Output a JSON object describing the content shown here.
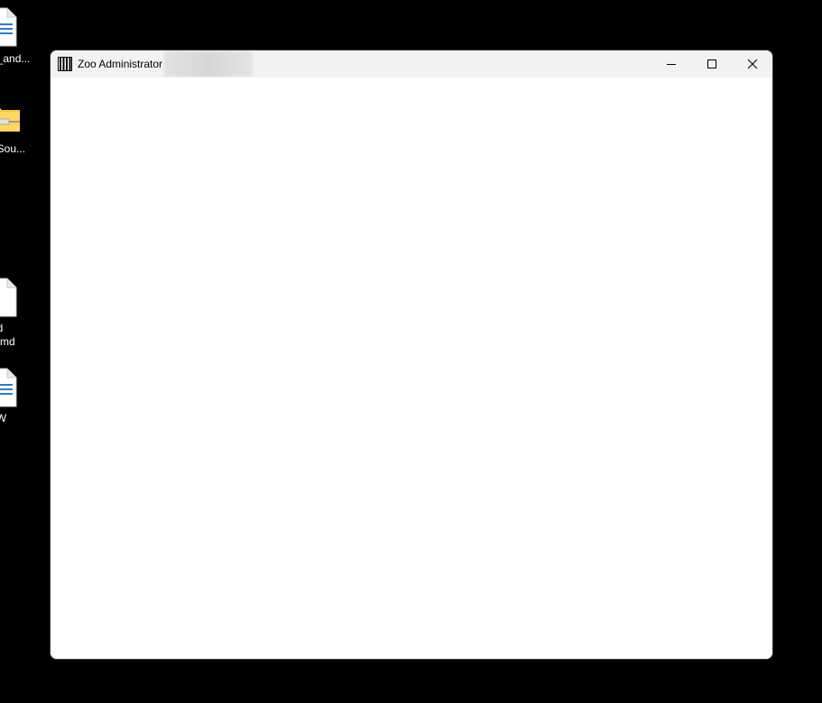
{
  "desktop": {
    "icons": [
      {
        "label": "e_and...",
        "icon": "word-document-icon"
      },
      {
        "label": "eSou...",
        "icon": "zip-folder-icon"
      },
      {
        "label": "nd\n.qmd",
        "icon": "blank-file-icon"
      },
      {
        "label": "LW",
        "icon": "word-document-icon"
      }
    ]
  },
  "window": {
    "title": "Zoo Administrator",
    "app_icon": "cage-bars-icon",
    "buttons": {
      "minimize": "minimize-icon",
      "maximize": "maximize-icon",
      "close": "close-icon"
    }
  },
  "colors": {
    "desktop_background": "#000000",
    "titlebar_background": "#f2f2f2",
    "window_background": "#ffffff",
    "word_blue": "#2b7cd3",
    "zip_yellow": "#f4c842"
  }
}
